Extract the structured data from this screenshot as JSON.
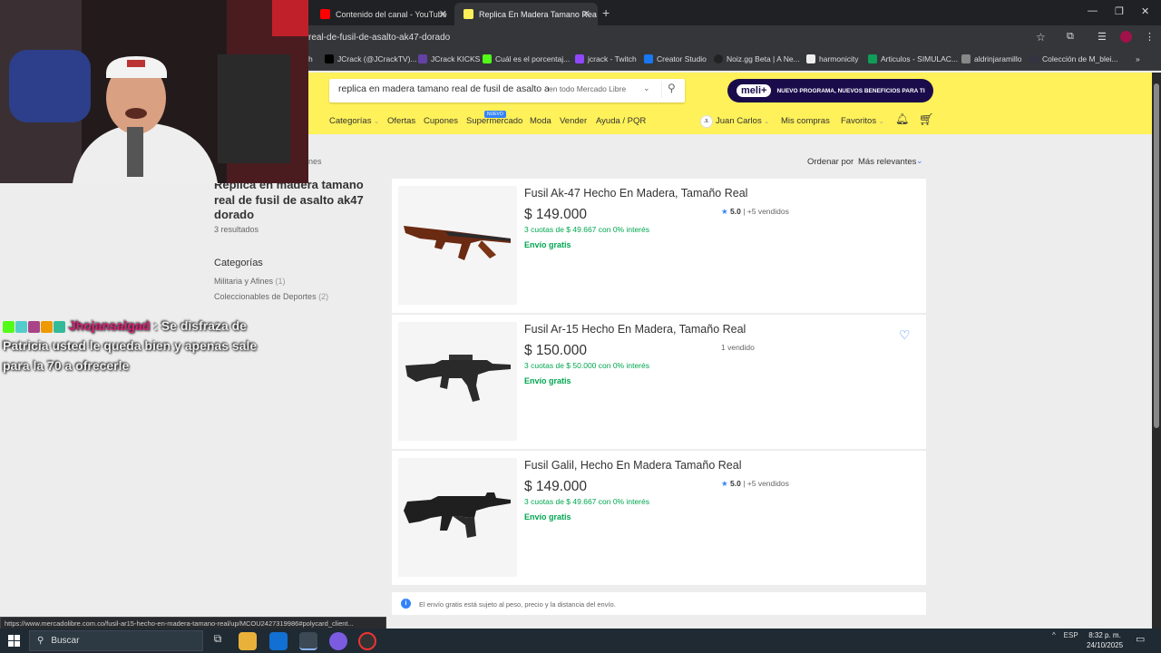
{
  "browser": {
    "tabs": [
      {
        "label": "Contenido del canal - YouTube"
      },
      {
        "label": "Replica En Madera Tamano Rea"
      }
    ],
    "url": "real-de-fusil-de-asalto-ak47-dorado",
    "bookmarks": [
      "h",
      "JCrack (@JCrackTV)...",
      "JCrack KICKS",
      "Cuál es el porcentaj...",
      "jcrack - Twitch",
      "Creator Studio",
      "Noiz.gg Beta | A Ne...",
      "harmonicity",
      "Articulos - SIMULAC...",
      "aldrinjaramillo",
      "Colección de M_blei..."
    ],
    "status_url": "https://www.mercadolibre.com.co/fusil-ar15-hecho-en-madera-tamano-real/up/MCOU2427319986#polycard_client..."
  },
  "header": {
    "search_value": "replica en madera tamano real de fusil de asalto a",
    "search_scope": "en todo Mercado Libre",
    "meli_logo": "meli+",
    "meli_text": "NUEVO PROGRAMA, NUEVOS BENEFICIOS PARA TI",
    "nav": {
      "categorias": "Categorías",
      "ofertas": "Ofertas",
      "cupones": "Cupones",
      "supermercado": "Supermercado",
      "nuevo": "NUEVO",
      "moda": "Moda",
      "vender": "Vender",
      "ayuda": "Ayuda / PQR",
      "avatar": "JL",
      "user": "Juan Carlos",
      "compras": "Mis compras",
      "favoritos": "Favoritos"
    }
  },
  "sidebar": {
    "breadcrumb_fragment": "nes",
    "query_title": "Replica en madera tamano real de fusil de asalto ak47 dorado",
    "results_count": "3 resultados",
    "categories_heading": "Categorías",
    "categories": [
      {
        "name": "Militaria y Afines",
        "count": "(1)"
      },
      {
        "name": "Coleccionables de Deportes",
        "count": "(2)"
      }
    ]
  },
  "sort": {
    "label": "Ordenar por",
    "value": "Más relevantes"
  },
  "products": [
    {
      "title": "Fusil Ak-47 Hecho En Madera, Tamaño Real",
      "price": "$ 149.000",
      "installments": "3 cuotas de $ 49.667 con 0% interés",
      "shipping": "Envío gratis",
      "rating": "5.0",
      "sold": "| +5 vendidos"
    },
    {
      "title": "Fusil Ar-15 Hecho En Madera, Tamaño Real",
      "price": "$ 150.000",
      "installments": "3 cuotas de $ 50.000 con 0% interés",
      "shipping": "Envío gratis",
      "rating": "",
      "sold": "1 vendido"
    },
    {
      "title": "Fusil Galil, Hecho En Madera Tamaño Real",
      "price": "$ 149.000",
      "installments": "3 cuotas de $ 49.667 con 0% interés",
      "shipping": "Envío gratis",
      "rating": "5.0",
      "sold": "| +5 vendidos"
    }
  ],
  "notice": "El envío gratis está sujeto al peso, precio y la distancia del envío.",
  "chat": {
    "username": "Jhojansalgad",
    "message": ": Se disfraza de Patricia usted le queda bien y apenas sale para la 70 a ofrecerle"
  },
  "taskbar": {
    "search": "Buscar",
    "lang": "ESP",
    "time": "8:32 p. m.",
    "date": "24/10/2025"
  },
  "colors": {
    "ml_yellow": "#fff159",
    "ml_blue": "#3483fa",
    "ml_green": "#00a650",
    "meli_purple": "#1a0c4b",
    "chat_user": "#e0207a"
  }
}
